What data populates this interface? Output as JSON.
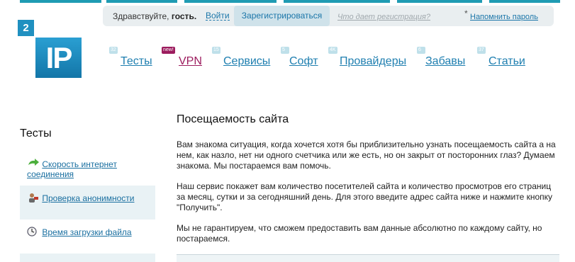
{
  "auth": {
    "greeting": "Здравствуйте,",
    "guest": "гость.",
    "login": "Войти",
    "register": "Зарегистрироваться",
    "what_register": "Что дает регистрация?",
    "asterisk": "*",
    "remind_password": "Напомнить пароль"
  },
  "logo": {
    "small": "2",
    "big": "IP"
  },
  "nav": {
    "items": [
      {
        "badge": "32",
        "label": "Тесты"
      },
      {
        "badge": "new!",
        "label": "VPN"
      },
      {
        "badge": "15",
        "label": "Сервисы"
      },
      {
        "badge": "5",
        "label": "Софт"
      },
      {
        "badge": "4K",
        "label": "Провайдеры"
      },
      {
        "badge": "6",
        "label": "Забавы"
      },
      {
        "badge": "37",
        "label": "Статьи"
      }
    ]
  },
  "sidebar": {
    "title": "Тесты",
    "items": [
      {
        "label": "Скорость интернет соединения",
        "icon": "speed-arrow-icon"
      },
      {
        "label": "Проверка анонимности",
        "icon": "anonymous-person-icon"
      },
      {
        "label": "Время загрузки файла",
        "icon": "clock-icon"
      }
    ]
  },
  "main": {
    "title": "Посещаемость сайта",
    "paragraphs": [
      "Вам знакома ситуация, когда хочется хотя бы приблизительно узнать посещаемость сайта а на нем, как назло, нет ни одного счетчика или же есть, но он закрыт от посторонних глаз? Думаем знакома. Мы постараемся вам помочь.",
      "Наш сервис покажет вам количество посетителей сайта и количество просмотров его страниц за месяц, сутки и за сегодняшний день. Для этого введите адрес сайта ниже и нажмите кнопку \"Получить\".",
      "Мы не гарантируем, что сможем предоставить вам данные абсолютно по каждому сайту, но постараемся."
    ]
  },
  "colors": {
    "accent": "#1f9bb3",
    "link": "#1f7fb0",
    "vpn": "#9c1c5e"
  }
}
